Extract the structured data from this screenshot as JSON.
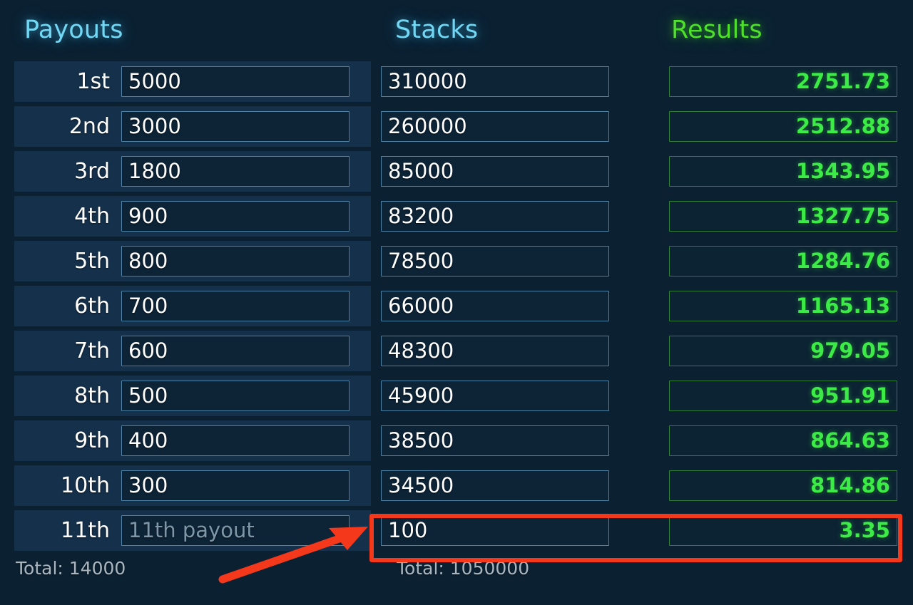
{
  "columns": {
    "payouts": {
      "header": "Payouts",
      "total_label": "Total: 14000",
      "rows": [
        {
          "rank": "1st",
          "value": "5000"
        },
        {
          "rank": "2nd",
          "value": "3000"
        },
        {
          "rank": "3rd",
          "value": "1800"
        },
        {
          "rank": "4th",
          "value": "900"
        },
        {
          "rank": "5th",
          "value": "800"
        },
        {
          "rank": "6th",
          "value": "700"
        },
        {
          "rank": "7th",
          "value": "600"
        },
        {
          "rank": "8th",
          "value": "500"
        },
        {
          "rank": "9th",
          "value": "400"
        },
        {
          "rank": "10th",
          "value": "300"
        },
        {
          "rank": "11th",
          "value": "",
          "placeholder": "11th payout"
        }
      ]
    },
    "stacks": {
      "header": "Stacks",
      "total_label": "Total: 1050000",
      "rows": [
        {
          "value": "310000"
        },
        {
          "value": "260000"
        },
        {
          "value": "85000"
        },
        {
          "value": "83200"
        },
        {
          "value": "78500"
        },
        {
          "value": "66000"
        },
        {
          "value": "48300"
        },
        {
          "value": "45900"
        },
        {
          "value": "38500"
        },
        {
          "value": "34500"
        },
        {
          "value": "100"
        }
      ]
    },
    "results": {
      "header": "Results",
      "rows": [
        {
          "value": "2751.73"
        },
        {
          "value": "2512.88"
        },
        {
          "value": "1343.95"
        },
        {
          "value": "1327.75"
        },
        {
          "value": "1284.76"
        },
        {
          "value": "1165.13"
        },
        {
          "value": "979.05"
        },
        {
          "value": "951.91"
        },
        {
          "value": "864.63"
        },
        {
          "value": "814.86"
        },
        {
          "value": "3.35"
        }
      ]
    }
  },
  "annotations": {
    "highlight_color": "#f4381c",
    "arrow_color": "#f4381c",
    "highlight_target": "last-row-stack-and-result"
  },
  "theme": {
    "background": "#0b2132",
    "row_background": "#15304a",
    "field_background": "#0d2437",
    "field_border": "#4b82a6",
    "result_border": "#2f7f38",
    "result_text": "#3ceb47",
    "header_cyan": "#72d7f3",
    "header_green": "#4ee02a",
    "label_text": "#ffffff",
    "total_text": "#a9b6c0",
    "placeholder_text": "#7d97a8"
  }
}
